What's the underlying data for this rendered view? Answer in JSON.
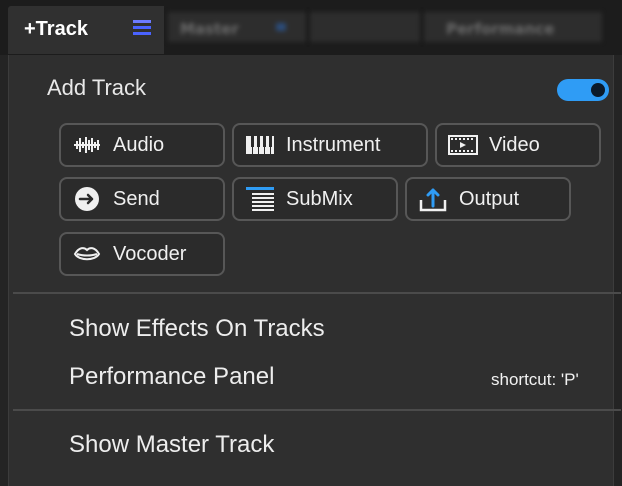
{
  "topbar": {
    "track_tab_label": "+Track",
    "blurred_tabs": [
      "Master",
      "Performance"
    ]
  },
  "panel": {
    "title": "Add Track",
    "toggle_on": true,
    "track_types": [
      {
        "label": "Audio",
        "icon": "waveform-icon"
      },
      {
        "label": "Instrument",
        "icon": "piano-keys-icon"
      },
      {
        "label": "Video",
        "icon": "film-icon"
      },
      {
        "label": "Send",
        "icon": "arrow-circle-icon"
      },
      {
        "label": "SubMix",
        "icon": "stack-lines-icon"
      },
      {
        "label": "Output",
        "icon": "upload-arrow-icon"
      },
      {
        "label": "Vocoder",
        "icon": "lips-icon"
      }
    ],
    "menu": {
      "show_effects": "Show Effects On Tracks",
      "performance_panel": "Performance Panel",
      "performance_shortcut": "shortcut: 'P'",
      "show_master": "Show Master Track"
    }
  },
  "colors": {
    "accent_blue": "#2f9cf5",
    "panel_bg": "#2f2f2f",
    "button_border": "#575757",
    "topbar_bg": "#1c1c1c"
  }
}
